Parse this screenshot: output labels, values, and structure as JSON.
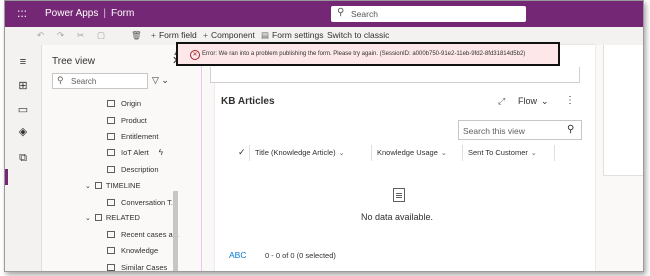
{
  "app": {
    "waffle": ":::",
    "name": "Power Apps",
    "separator": "|",
    "section": "Form",
    "search_placeholder": "Search",
    "brand_color": "#742774"
  },
  "commands": {
    "undo_glyph": "↶",
    "redo_glyph": "↷",
    "cut_glyph": "✂",
    "paste_glyph": "▢",
    "delete_glyph": "🗑",
    "form_field": "Form field",
    "component": "Component",
    "form_settings": "Form settings",
    "switch_classic": "Switch to classic"
  },
  "error": {
    "message": "Error: We ran into a problem publishing the form. Please try again. (SessionID: a000b750-91e2-11eb-9fd2-8fd31814d5b2)",
    "color": "#a4262c"
  },
  "tree": {
    "title": "Tree view",
    "search_placeholder": "Search",
    "items": [
      {
        "label": "Origin"
      },
      {
        "label": "Product"
      },
      {
        "label": "Entitlement"
      },
      {
        "label": "IoT Alert"
      },
      {
        "label": "Description"
      }
    ],
    "timeline_label": "TIMELINE",
    "timeline_items": [
      {
        "label": "Conversation T..."
      }
    ],
    "related_label": "RELATED",
    "related_items": [
      {
        "label": "Recent cases a..."
      },
      {
        "label": "Knowledge"
      },
      {
        "label": "Similar Cases"
      }
    ]
  },
  "kb": {
    "title": "KB Articles",
    "flow_label": "Flow",
    "search_placeholder": "Search this view",
    "columns": [
      {
        "label": "Title (Knowledge Article)"
      },
      {
        "label": "Knowledge Usage"
      },
      {
        "label": "Sent To Customer"
      }
    ],
    "empty_message": "No data available.",
    "footer_abc": "ABC",
    "footer_records": "0 - 0 of 0 (0 selected)"
  }
}
